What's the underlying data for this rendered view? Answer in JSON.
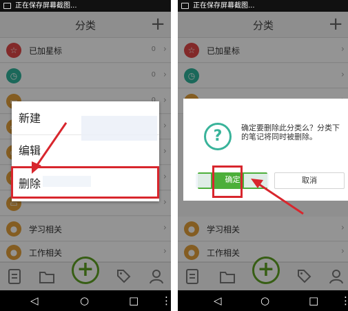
{
  "status_bar": {
    "text": "正在保存屏幕截图..."
  },
  "app_header": {
    "title": "分类",
    "add_icon": "plus-icon"
  },
  "category_list": [
    {
      "label": "已加星标",
      "count": "0",
      "color": "#e04848",
      "icon": "star-icon"
    },
    {
      "label": "",
      "count": "0",
      "color": "#2fb39b",
      "icon": "clock-icon"
    },
    {
      "label": "",
      "count": "0",
      "color": "#e3a13b",
      "icon": "folder-icon"
    },
    {
      "label": "",
      "count": "",
      "color": "#e3a13b",
      "icon": "folder-icon"
    },
    {
      "label": "",
      "count": "",
      "color": "#e3a13b",
      "icon": "folder-icon"
    },
    {
      "label": "",
      "count": "",
      "color": "#e3a13b",
      "icon": "folder-icon"
    },
    {
      "label": "",
      "count": "",
      "color": "#e3a13b",
      "icon": "folder-icon"
    },
    {
      "label": "学习相关",
      "count": "",
      "color": "#e3a13b",
      "icon": "person-icon"
    },
    {
      "label": "工作相关",
      "count": "",
      "color": "#e3a13b",
      "icon": "person-icon"
    }
  ],
  "context_menu": {
    "items": [
      "新建",
      "编辑",
      "删除"
    ]
  },
  "confirm_dialog": {
    "message": "确定要删除此分类么？分类下的笔记将同时被删除。",
    "ok_label": "确定",
    "cancel_label": "取消"
  },
  "bottom_tabs": [
    "notes-icon",
    "folder-icon",
    "add-icon",
    "tag-icon",
    "profile-icon"
  ],
  "nav_bar": [
    "back-icon",
    "home-icon",
    "recents-icon",
    "more-icon"
  ],
  "colors": {
    "accent_green": "#5fa324",
    "highlight_red": "#d8262d",
    "dialog_teal": "#39b39a"
  }
}
